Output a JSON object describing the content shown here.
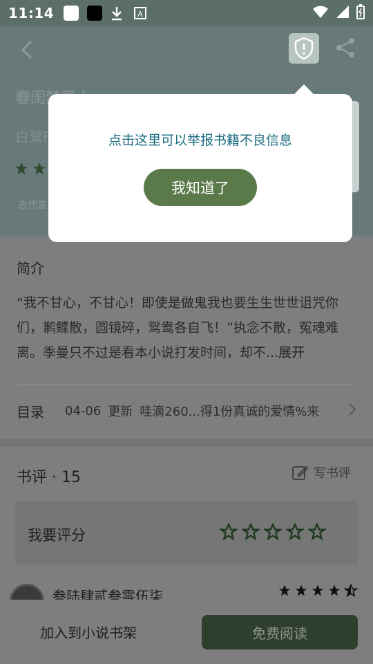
{
  "status_bar": {
    "time": "11:14"
  },
  "book": {
    "title": "春闺禁男人",
    "author": "白鹭F",
    "tag": "古代言",
    "rating_stars": 2
  },
  "popup": {
    "message": "点击这里可以举报书籍不良信息",
    "button_label": "我知道了"
  },
  "intro": {
    "heading": "简介",
    "text": "“我不甘心，不甘心！即使是做鬼我也要生生世世诅咒你们，鹣鲽散，圆镜碎，鸳鸯各自飞！”执念不散，冤魂难离。季曼只不过是看本小说打发时间，却不...",
    "more_label": "展开"
  },
  "toc": {
    "label": "目录",
    "date": "04-06",
    "update_label": "更新",
    "latest": "哇滴260...得1份真诚的爱情%来"
  },
  "reviews": {
    "title": "书评 · 15",
    "write_label": "写书评",
    "rate_label": "我要评分",
    "rate_max": 5,
    "first_user": "叁陆肆贰叁零伍柒",
    "first_rating": 4.5
  },
  "bottom": {
    "add_shelf_label": "加入到小说书架",
    "read_label": "免费阅读"
  },
  "colors": {
    "accent_green": "#5a7a4a",
    "popup_text": "#1a6b80",
    "overlay_tint": "#7e7e7e"
  }
}
